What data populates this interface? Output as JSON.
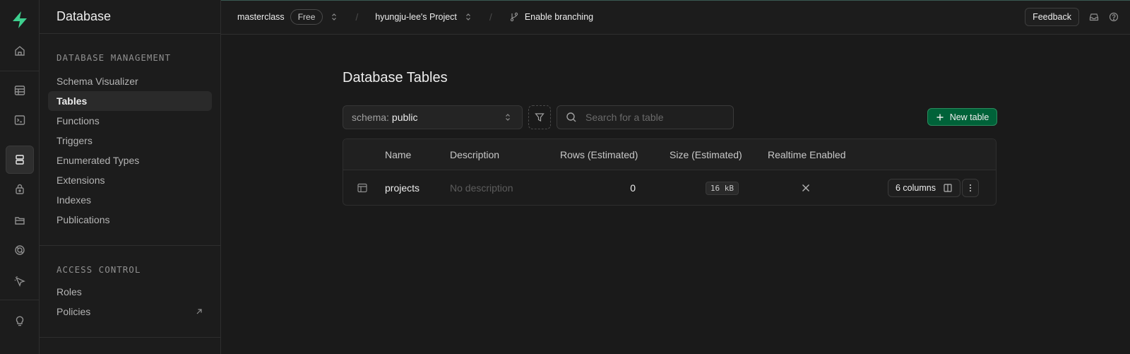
{
  "app": {
    "section_title": "Database",
    "accent_color": "#3ecf8e"
  },
  "rail": {
    "items": [
      {
        "icon": "home-icon",
        "active": false
      },
      {
        "icon": "table-editor-icon",
        "active": false
      },
      {
        "icon": "sql-editor-icon",
        "active": false
      },
      {
        "icon": "database-icon",
        "active": true
      },
      {
        "icon": "auth-lock-icon",
        "active": false
      },
      {
        "icon": "storage-icon",
        "active": false
      },
      {
        "icon": "realtime-icon",
        "active": false
      },
      {
        "icon": "edge-functions-icon",
        "active": false
      },
      {
        "icon": "advisors-lightbulb-icon",
        "active": false
      }
    ]
  },
  "menu": {
    "management_title": "DATABASE MANAGEMENT",
    "management_items": [
      "Schema Visualizer",
      "Tables",
      "Functions",
      "Triggers",
      "Enumerated Types",
      "Extensions",
      "Indexes",
      "Publications"
    ],
    "active_item": "Tables",
    "access_title": "ACCESS CONTROL",
    "access_items": [
      "Roles",
      "Policies"
    ]
  },
  "topbar": {
    "org": "masterclass",
    "plan_badge": "Free",
    "project": "hyungju-lee's Project",
    "branching": "Enable branching",
    "feedback": "Feedback"
  },
  "main": {
    "title": "Database Tables",
    "schema_prefix": "schema:",
    "schema_value": "public",
    "search_placeholder": "Search for a table",
    "new_table_label": "New table",
    "columns": [
      "Name",
      "Description",
      "Rows (Estimated)",
      "Size (Estimated)",
      "Realtime Enabled"
    ],
    "rows": [
      {
        "name": "projects",
        "description": "No description",
        "rows": "0",
        "size": "16 kB",
        "realtime": false,
        "columns_label": "6 columns"
      }
    ]
  }
}
